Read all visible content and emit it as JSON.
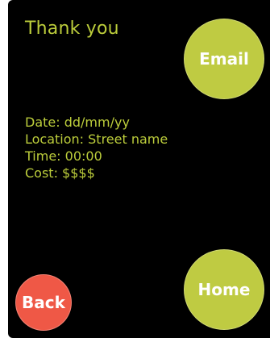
{
  "screen": {
    "title": "Thank you",
    "details": [
      "Date: dd/mm/yy",
      "Location: Street name",
      "Time: 00:00",
      "Cost: $$$$"
    ]
  },
  "buttons": {
    "email_label": "Email",
    "home_label": "Home",
    "back_label": "Back"
  },
  "colors": {
    "background": "#000000",
    "accent_green": "#bfcb42",
    "text_green": "#bccd3b",
    "back_red": "#ef5846",
    "button_text": "#ffffff"
  }
}
